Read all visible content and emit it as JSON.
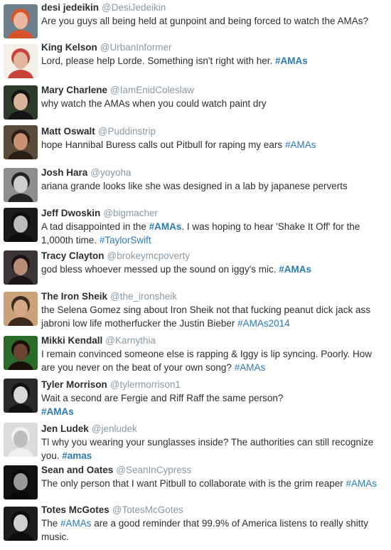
{
  "tweets": [
    {
      "name": "desi jedeikin",
      "handle": "@DesiJedeikin",
      "segments": [
        {
          "t": "Are you guys all being held at gunpoint and being forced to watch the AMAs?"
        }
      ],
      "avatar": {
        "bg": "#6b7f8c",
        "face": "#e8b8a0",
        "hair": "#d8522a"
      }
    },
    {
      "name": "King Kelson",
      "handle": "@UrbanInformer",
      "segments": [
        {
          "t": "Lord, please help Lorde. Something isn't right with her. "
        },
        {
          "t": "#AMAs",
          "tag": true
        }
      ],
      "avatar": {
        "bg": "#f4efe8",
        "face": "#e3b79d",
        "hair": "#c7423a"
      }
    },
    {
      "name": "Mary Charlene",
      "handle": "@IamEnidColeslaw",
      "segments": [
        {
          "t": "why watch the AMAs when you could watch paint dry"
        }
      ],
      "avatar": {
        "bg": "#2e3a2a",
        "face": "#d9b49a",
        "hair": "#141414"
      }
    },
    {
      "name": "Matt Oswalt",
      "handle": "@Puddinstrip",
      "segments": [
        {
          "t": "hope Hannibal Buress calls out Pitbull for raping my ears "
        },
        {
          "t": "#AMAs",
          "tag": true,
          "plain": true
        }
      ],
      "avatar": {
        "bg": "#5b4b3a",
        "face": "#c99272",
        "hair": "#2a1d14"
      }
    },
    {
      "name": "Josh Hara",
      "handle": "@yoyoha",
      "segments": [
        {
          "t": "ariana grande looks like she was designed in a lab by japanese perverts"
        }
      ],
      "avatar": {
        "bg": "#8e8e8e",
        "face": "#cfcfcf",
        "hair": "#222222"
      }
    },
    {
      "name": "Jeff Dwoskin",
      "handle": "@bigmacher",
      "segments": [
        {
          "t": "A tad disappointed in the "
        },
        {
          "t": "#AMAs",
          "tag": true
        },
        {
          "t": ". I was hoping to hear 'Shake It Off' for the 1,000th time. "
        },
        {
          "t": "#TaylorSwift",
          "tag": true,
          "plain": true
        }
      ],
      "avatar": {
        "bg": "#1a1a1a",
        "face": "#bcbcbc",
        "hair": "#0d0d0d"
      }
    },
    {
      "name": "Tracy Clayton",
      "handle": "@brokeymcpoverty",
      "segments": [
        {
          "t": "god bless whoever messed up the sound on iggy's mic. "
        },
        {
          "t": "#AMAs",
          "tag": true
        }
      ],
      "avatar": {
        "bg": "#3b3438",
        "face": "#b98c78",
        "hair": "#1a1414"
      }
    },
    {
      "name": "The Iron Sheik",
      "handle": "@the_ironsheik",
      "segments": [
        {
          "t": "the Selena Gomez sing about Iron Sheik not that fucking peanut dick jack ass jabroni low life motherfucker the Justin Bieber "
        },
        {
          "t": "#AMAs2014",
          "tag": true,
          "plain": true
        }
      ],
      "avatar": {
        "bg": "#c9a27a",
        "face": "#d6a886",
        "hair": "#3a2a1e"
      }
    },
    {
      "name": "Mikki Kendall",
      "handle": "@Karnythia",
      "segments": [
        {
          "t": "I remain convinced someone else is rapping & Iggy is lip syncing. Poorly. How are you never on the beat of your own song? "
        },
        {
          "t": "#AMAs",
          "tag": true,
          "plain": true
        }
      ],
      "avatar": {
        "bg": "#2b6b2a",
        "face": "#6a4430",
        "hair": "#1a0f0a"
      }
    },
    {
      "name": "Tyler Morrison",
      "handle": "@tylermorrison1",
      "segments": [
        {
          "t": "Wait a second are Fergie and Riff Raff the same person?"
        },
        {
          "t": "#AMAs",
          "tag": true,
          "newline": true
        }
      ],
      "avatar": {
        "bg": "#2a2a2a",
        "face": "#d8d8d8",
        "hair": "#111111"
      }
    },
    {
      "name": "Jen Ludek",
      "handle": "@jenludek",
      "segments": [
        {
          "t": "Tl why you wearing your sunglasses inside? The authorities can still recognize you. "
        },
        {
          "t": "#amas",
          "tag": true
        }
      ],
      "avatar": {
        "bg": "#dcdcdc",
        "face": "#bdbdbd",
        "hair": "#f0f0f0"
      }
    },
    {
      "name": "Sean and Oates",
      "handle": "@SeanInCypress",
      "segments": [
        {
          "t": "The only person that I want Pitbull to collaborate with is the grim reaper "
        },
        {
          "t": "#AMAs",
          "tag": true,
          "plain": true
        }
      ],
      "avatar": {
        "bg": "#111111",
        "face": "#9a9a9a",
        "hair": "#0a0a0a"
      }
    },
    {
      "name": "Totes McGotes",
      "handle": "@TotesMcGotes",
      "segments": [
        {
          "t": "The "
        },
        {
          "t": "#AMAs",
          "tag": true,
          "plain": true
        },
        {
          "t": " are a good reminder that 99.9% of America listens to really shitty music."
        }
      ],
      "avatar": {
        "bg": "#1c1c1c",
        "face": "#cfcfcf",
        "hair": "#0c0c0c"
      }
    }
  ]
}
